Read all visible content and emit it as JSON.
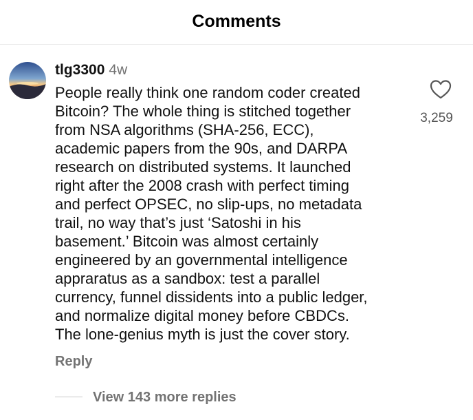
{
  "header": {
    "title": "Comments"
  },
  "comment": {
    "avatar_icon": "sunset-landscape-avatar",
    "username": "tlg3300",
    "time": "4w",
    "text": "People really think one random coder created\nBitcoin? The whole thing is stitched together\nfrom NSA algorithms (SHA-256, ECC),\nacademic papers from the 90s, and DARPA\nresearch on distributed systems. It launched\nright after the 2008 crash with perfect timing\nand perfect OPSEC, no slip-ups, no metadata\ntrail, no way that’s just ‘Satoshi in his\nbasement.’ Bitcoin was almost certainly\nengineered by an governmental intelligence\napprаratus as a sandbox: test a parallel\ncurrency, funnel dissidents into a public ledger,\nand normalize digital money before CBDCs.\nThe lone-genius myth is just the cover story.",
    "like_icon": "heart-outline-icon",
    "like_count": "3,259",
    "reply_label": "Reply",
    "view_replies_label": "View 143 more replies"
  },
  "colors": {
    "background": "#ffffff",
    "text": "#111111",
    "muted": "#737373",
    "divider": "#ececec"
  }
}
